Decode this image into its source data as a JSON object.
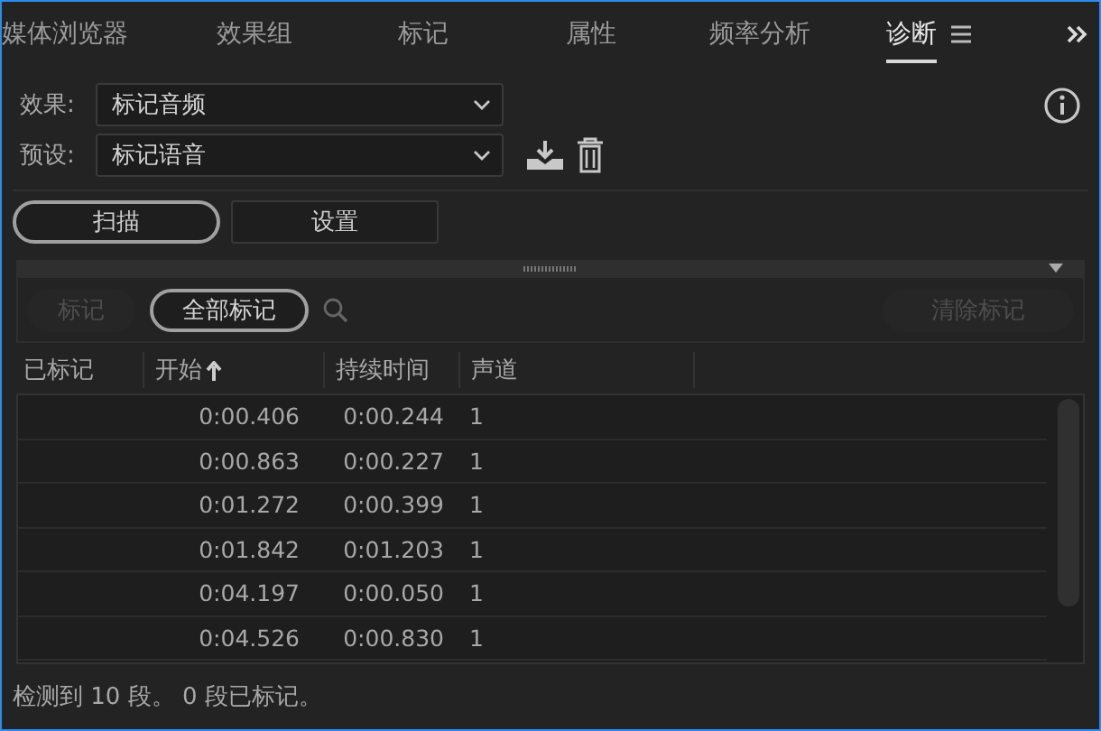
{
  "tabs": [
    {
      "label": "媒体浏览器",
      "selected": false
    },
    {
      "label": "效果组",
      "selected": false
    },
    {
      "label": "标记",
      "selected": false
    },
    {
      "label": "属性",
      "selected": false
    },
    {
      "label": "频率分析",
      "selected": false
    },
    {
      "label": "诊断",
      "selected": true
    }
  ],
  "effect": {
    "label": "效果:",
    "value": "标记音频"
  },
  "preset": {
    "label": "预设:",
    "value": "标记语音"
  },
  "mode_tabs": [
    {
      "label": "扫描",
      "selected": true
    },
    {
      "label": "设置",
      "selected": false
    }
  ],
  "filters": [
    {
      "label": "标记",
      "selected": false,
      "disabled": true
    },
    {
      "label": "全部标记",
      "selected": true,
      "disabled": false
    }
  ],
  "clear_button": {
    "label": "清除标记",
    "disabled": true
  },
  "table": {
    "columns": [
      {
        "label": "已标记",
        "sorted": false
      },
      {
        "label": "开始",
        "sorted": true
      },
      {
        "label": "持续时间",
        "sorted": false
      },
      {
        "label": "声道",
        "sorted": false
      }
    ],
    "rows": [
      [
        "",
        "0:00.406",
        "0:00.244",
        "1"
      ],
      [
        "",
        "0:00.863",
        "0:00.227",
        "1"
      ],
      [
        "",
        "0:01.272",
        "0:00.399",
        "1"
      ],
      [
        "",
        "0:01.842",
        "0:01.203",
        "1"
      ],
      [
        "",
        "0:04.197",
        "0:00.050",
        "1"
      ],
      [
        "",
        "0:04.526",
        "0:00.830",
        "1"
      ]
    ]
  },
  "status_bar": "检测到 10 段。 0 段已标记。"
}
